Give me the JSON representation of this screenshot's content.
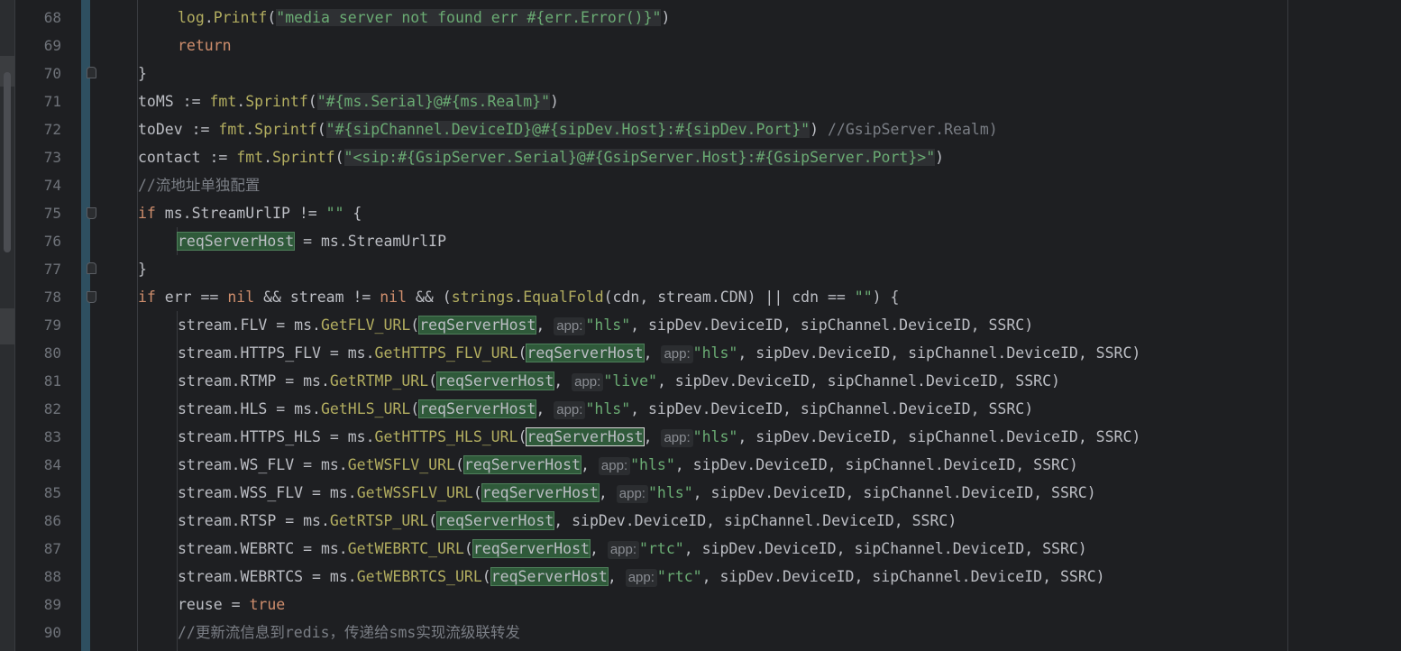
{
  "gutter": {
    "line_numbers": [
      "68",
      "69",
      "70",
      "71",
      "72",
      "73",
      "74",
      "75",
      "76",
      "77",
      "78",
      "79",
      "80",
      "81",
      "82",
      "83",
      "84",
      "85",
      "86",
      "87",
      "88",
      "89",
      "90"
    ]
  },
  "lines": {
    "l68": {
      "a": "log",
      "b": ".",
      "c": "Printf",
      "d": "(",
      "e": "\"media server not found err #{err.Error()}\"",
      "f": ")"
    },
    "l69": {
      "a": "return"
    },
    "l70": {
      "a": "}"
    },
    "l71": {
      "a": "toMS := ",
      "b": "fmt",
      "c": ".",
      "d": "Sprintf",
      "e": "(",
      "f": "\"#{ms.Serial}@#{ms.Realm}\"",
      "g": ")"
    },
    "l72": {
      "a": "toDev := ",
      "b": "fmt",
      "c": ".",
      "d": "Sprintf",
      "e": "(",
      "f": "\"#{sipChannel.DeviceID}@#{sipDev.Host}:#{sipDev.Port}\"",
      "g": ") ",
      "h": "//GsipServer.Realm)"
    },
    "l73": {
      "a": "contact := ",
      "b": "fmt",
      "c": ".",
      "d": "Sprintf",
      "e": "(",
      "f": "\"<sip:#{GsipServer.Serial}@#{GsipServer.Host}:#{GsipServer.Port}>\"",
      "g": ")"
    },
    "l74": {
      "a": "//流地址单独配置"
    },
    "l75": {
      "a": "if",
      "b": " ms.StreamUrlIP != ",
      "c": "\"\"",
      "d": " {"
    },
    "l76": {
      "a": "reqServerHost",
      "b": " = ms.StreamUrlIP"
    },
    "l77": {
      "a": "}"
    },
    "l78": {
      "a": "if",
      "b": " err == ",
      "c": "nil",
      "d": " && stream != ",
      "e": "nil",
      "f": " && (",
      "g": "strings",
      "h": ".",
      "i": "EqualFold",
      "j": "(cdn, stream.CDN) || cdn == ",
      "k": "\"\"",
      "l": ") {"
    },
    "l79": {
      "pre": "stream.FLV = ms.",
      "fn": "GetFLV_URL",
      "op": "(",
      "host": "reqServerHost",
      "c1": ", ",
      "hint": "app:",
      "str": "\"hls\"",
      "rest": ", sipDev.DeviceID, sipChannel.DeviceID, SSRC)"
    },
    "l80": {
      "pre": "stream.HTTPS_FLV = ms.",
      "fn": "GetHTTPS_FLV_URL",
      "op": "(",
      "host": "reqServerHost",
      "c1": ", ",
      "hint": "app:",
      "str": "\"hls\"",
      "rest": ", sipDev.DeviceID, sipChannel.DeviceID, SSRC)"
    },
    "l81": {
      "pre": "stream.RTMP = ms.",
      "fn": "GetRTMP_URL",
      "op": "(",
      "host": "reqServerHost",
      "c1": ", ",
      "hint": "app:",
      "str": "\"live\"",
      "rest": ", sipDev.DeviceID, sipChannel.DeviceID, SSRC)"
    },
    "l82": {
      "pre": "stream.HLS = ms.",
      "fn": "GetHLS_URL",
      "op": "(",
      "host": "reqServerHost",
      "c1": ", ",
      "hint": "app:",
      "str": "\"hls\"",
      "rest": ", sipDev.DeviceID, sipChannel.DeviceID, SSRC)"
    },
    "l83": {
      "pre": "stream.HTTPS_HLS = ms.",
      "fn": "GetHTTPS_HLS_URL",
      "op": "(",
      "host": "reqServerHost",
      "c1": ", ",
      "hint": "app:",
      "str": "\"hls\"",
      "rest": ", sipDev.DeviceID, sipChannel.DeviceID, SSRC)"
    },
    "l84": {
      "pre": "stream.WS_FLV = ms.",
      "fn": "GetWSFLV_URL",
      "op": "(",
      "host": "reqServerHost",
      "c1": ", ",
      "hint": "app:",
      "str": "\"hls\"",
      "rest": ", sipDev.DeviceID, sipChannel.DeviceID, SSRC)"
    },
    "l85": {
      "pre": "stream.WSS_FLV = ms.",
      "fn": "GetWSSFLV_URL",
      "op": "(",
      "host": "reqServerHost",
      "c1": ", ",
      "hint": "app:",
      "str": "\"hls\"",
      "rest": ", sipDev.DeviceID, sipChannel.DeviceID, SSRC)"
    },
    "l86": {
      "pre": "stream.RTSP = ms.",
      "fn": "GetRTSP_URL",
      "op": "(",
      "host": "reqServerHost",
      "rest": ", sipDev.DeviceID, sipChannel.DeviceID, SSRC)"
    },
    "l87": {
      "pre": "stream.WEBRTC = ms.",
      "fn": "GetWEBRTC_URL",
      "op": "(",
      "host": "reqServerHost",
      "c1": ", ",
      "hint": "app:",
      "str": "\"rtc\"",
      "rest": ", sipDev.DeviceID, sipChannel.DeviceID, SSRC)"
    },
    "l88": {
      "pre": "stream.WEBRTCS = ms.",
      "fn": "GetWEBRTCS_URL",
      "op": "(",
      "host": "reqServerHost",
      "c1": ", ",
      "hint": "app:",
      "str": "\"rtc\"",
      "rest": ", sipDev.DeviceID, sipChannel.DeviceID, SSRC)"
    },
    "l89": {
      "a": "reuse = ",
      "b": "true"
    },
    "l90": {
      "a": "//更新流信息到redis，传递给sms实现流级联转发"
    }
  }
}
